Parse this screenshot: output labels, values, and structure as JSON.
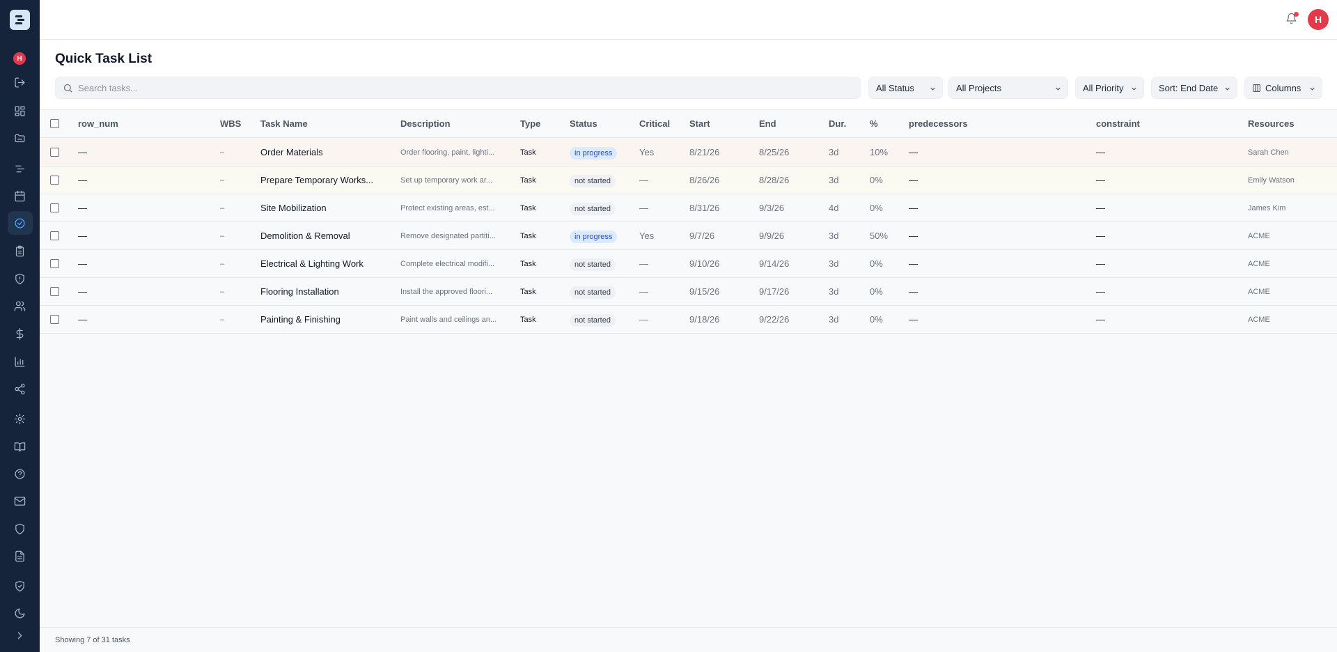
{
  "sidebar": {
    "avatar_initial": "H",
    "icons": [
      "logout-icon",
      "dashboard-icon",
      "folder-icon",
      "gantt-icon",
      "calendar-icon",
      "tasks-icon",
      "clipboard-icon",
      "shield-icon",
      "users-icon",
      "dollar-icon",
      "bar-chart-icon",
      "share-icon",
      "settings-icon",
      "book-icon",
      "help-icon",
      "mail-icon",
      "shield-outline-icon",
      "document-icon",
      "shield-check-icon",
      "moon-icon",
      "chevron-right-icon"
    ],
    "active_icon": "tasks-icon"
  },
  "topbar": {
    "avatar_initial": "H",
    "notification_dot_color": "#ef4444"
  },
  "page": {
    "title": "Quick Task List"
  },
  "search": {
    "placeholder": "Search tasks..."
  },
  "filters": {
    "status": "All Status",
    "projects": "All Projects",
    "priority": "All Priority",
    "sort": "Sort: End Date",
    "columns": "Columns"
  },
  "table": {
    "headers": {
      "row_num": "row_num",
      "wbs": "WBS",
      "task_name": "Task Name",
      "description": "Description",
      "type": "Type",
      "status": "Status",
      "critical": "Critical",
      "start": "Start",
      "end": "End",
      "duration": "Dur.",
      "percent": "%",
      "predecessors": "predecessors",
      "constraint": "constraint",
      "resources": "Resources"
    },
    "rows": [
      {
        "row_num": "—",
        "wbs": "–",
        "name": "Order Materials",
        "description": "Order flooring, paint, lighti...",
        "type": "Task",
        "status": "in progress",
        "status_key": "in_progress",
        "critical": "Yes",
        "start": "8/21/26",
        "end": "8/25/26",
        "duration": "3d",
        "percent": "10%",
        "predecessors": "—",
        "constraint": "—",
        "resources": "Sarah Chen"
      },
      {
        "row_num": "—",
        "wbs": "–",
        "name": "Prepare Temporary Works...",
        "description": "Set up temporary work ar...",
        "type": "Task",
        "status": "not started",
        "status_key": "not_started",
        "critical": "—",
        "start": "8/26/26",
        "end": "8/28/26",
        "duration": "3d",
        "percent": "0%",
        "predecessors": "—",
        "constraint": "—",
        "resources": "Emily Watson"
      },
      {
        "row_num": "—",
        "wbs": "–",
        "name": "Site Mobilization",
        "description": "Protect existing areas, est...",
        "type": "Task",
        "status": "not started",
        "status_key": "not_started",
        "critical": "—",
        "start": "8/31/26",
        "end": "9/3/26",
        "duration": "4d",
        "percent": "0%",
        "predecessors": "—",
        "constraint": "—",
        "resources": "James Kim"
      },
      {
        "row_num": "—",
        "wbs": "–",
        "name": "Demolition & Removal",
        "description": "Remove designated partiti...",
        "type": "Task",
        "status": "in progress",
        "status_key": "in_progress",
        "critical": "Yes",
        "start": "9/7/26",
        "end": "9/9/26",
        "duration": "3d",
        "percent": "50%",
        "predecessors": "—",
        "constraint": "—",
        "resources": "ACME"
      },
      {
        "row_num": "—",
        "wbs": "–",
        "name": "Electrical & Lighting Work",
        "description": "Complete electrical modifi...",
        "type": "Task",
        "status": "not started",
        "status_key": "not_started",
        "critical": "—",
        "start": "9/10/26",
        "end": "9/14/26",
        "duration": "3d",
        "percent": "0%",
        "predecessors": "—",
        "constraint": "—",
        "resources": "ACME"
      },
      {
        "row_num": "—",
        "wbs": "–",
        "name": "Flooring Installation",
        "description": "Install the approved floori...",
        "type": "Task",
        "status": "not started",
        "status_key": "not_started",
        "critical": "—",
        "start": "9/15/26",
        "end": "9/17/26",
        "duration": "3d",
        "percent": "0%",
        "predecessors": "—",
        "constraint": "—",
        "resources": "ACME"
      },
      {
        "row_num": "—",
        "wbs": "–",
        "name": "Painting & Finishing",
        "description": "Paint walls and ceilings an...",
        "type": "Task",
        "status": "not started",
        "status_key": "not_started",
        "critical": "—",
        "start": "9/18/26",
        "end": "9/22/26",
        "duration": "3d",
        "percent": "0%",
        "predecessors": "—",
        "constraint": "—",
        "resources": "ACME"
      }
    ]
  },
  "footer": {
    "summary": "Showing 7 of 31 tasks"
  },
  "colors": {
    "sidebar": "#15233b",
    "accent": "#4da3ff",
    "avatar": "#e23a4a",
    "in_progress_bg": "#dbeafe",
    "in_progress_text": "#1d4ed8"
  }
}
